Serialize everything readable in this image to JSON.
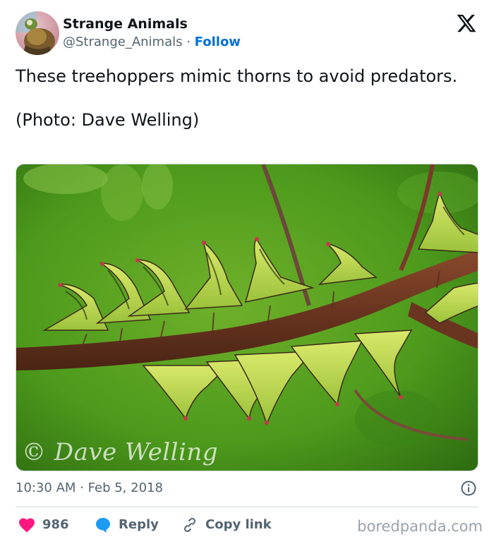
{
  "author": {
    "display_name": "Strange Animals",
    "handle": "@Strange_Animals",
    "separator": " · ",
    "follow_label": "Follow",
    "avatar_icon": "avatar-image"
  },
  "tweet": {
    "text_line1": "These treehoppers mimic thorns to avoid predators.",
    "text_line2": "(Photo: Dave Welling)"
  },
  "media": {
    "watermark": "© Dave Welling",
    "description_icon": "photo-treehoppers-on-branch"
  },
  "meta": {
    "time": "10:30 AM",
    "separator": " · ",
    "date": "Feb 5, 2018",
    "info_icon": "info-icon"
  },
  "actions": {
    "like_count": "986",
    "reply_label": "Reply",
    "copy_label": "Copy link"
  },
  "source": {
    "label": "boredpanda.com"
  },
  "colors": {
    "follow": "#006fd6",
    "like_heart": "#f91880",
    "reply_bubble": "#1d9bf0",
    "secondary_text": "#536471",
    "primary_text": "#0f1419"
  }
}
